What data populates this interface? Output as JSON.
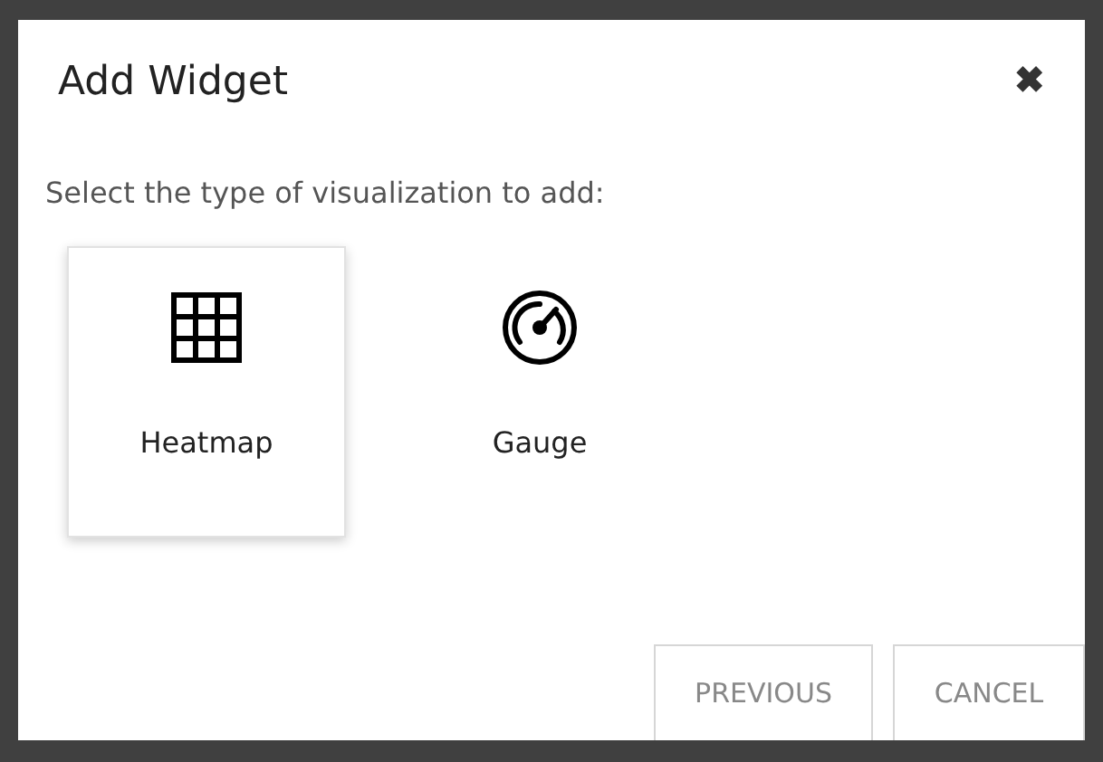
{
  "dialog": {
    "title": "Add Widget",
    "close": "✖",
    "prompt": "Select the type of visualization to add:",
    "options": [
      {
        "kind": "heatmap",
        "label": "Heatmap",
        "selected": true
      },
      {
        "kind": "gauge",
        "label": "Gauge",
        "selected": false
      }
    ],
    "buttons": [
      "PREVIOUS",
      "CANCEL"
    ]
  }
}
